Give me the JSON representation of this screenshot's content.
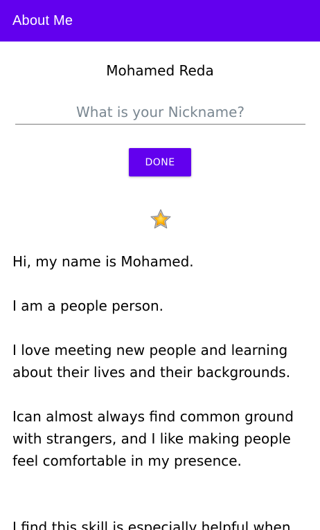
{
  "app_bar": {
    "title": "About Me",
    "color": "#6200ee"
  },
  "profile": {
    "name": "Mohamed Reda"
  },
  "nickname_field": {
    "value": "",
    "placeholder": "What is your Nickname?"
  },
  "done_button": {
    "label": "DONE",
    "color": "#6200ee"
  },
  "star": {
    "icon": "star-icon"
  },
  "bio": {
    "text": "Hi, my name is Mohamed.\n\nI am a people person.\n\nI love meeting new people and learning about their lives and their backgrounds.\n\nIcan almost always find common ground with strangers, and I like making people feel comfortable in my presence.\n\n\nI find this skill is especially helpful when"
  }
}
